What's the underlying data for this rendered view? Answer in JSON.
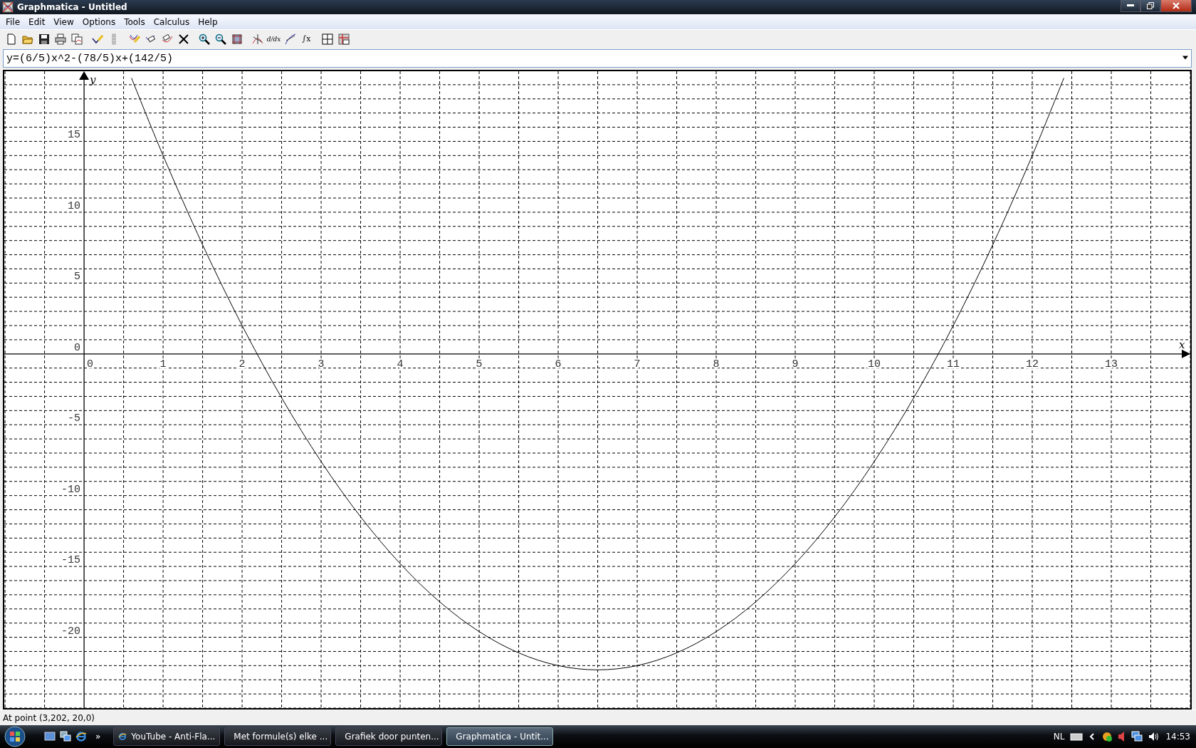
{
  "window": {
    "title": "Graphmatica - Untitled"
  },
  "menu": [
    "File",
    "Edit",
    "View",
    "Options",
    "Tools",
    "Calculus",
    "Help"
  ],
  "toolbar": {
    "groups": [
      [
        {
          "kind": "new"
        },
        {
          "kind": "open"
        },
        {
          "kind": "save"
        },
        {
          "kind": "print"
        },
        {
          "kind": "copy"
        }
      ],
      [
        {
          "kind": "pencil"
        },
        {
          "kind": "grip"
        }
      ],
      [
        {
          "kind": "graph-add"
        },
        {
          "kind": "eraser"
        },
        {
          "kind": "eraser-curve"
        },
        {
          "kind": "delete"
        }
      ],
      [
        {
          "kind": "zoom-in"
        },
        {
          "kind": "zoom-out"
        },
        {
          "kind": "fit"
        }
      ],
      [
        {
          "kind": "tangent"
        },
        {
          "kind": "derivative",
          "label": "d/dx"
        },
        {
          "kind": "slope"
        },
        {
          "kind": "integral",
          "label": "∫x"
        }
      ],
      [
        {
          "kind": "table"
        },
        {
          "kind": "table-edit"
        }
      ]
    ]
  },
  "equation": {
    "value": "y=(6/5)x^2-(78/5)x+(142/5)"
  },
  "graph": {
    "chart_data": {
      "type": "line",
      "xlabel": "x",
      "ylabel": "y",
      "xlim": [
        -1.01,
        14.0
      ],
      "ylim": [
        -25,
        19.95
      ],
      "xticks": [
        0,
        1,
        2,
        3,
        4,
        5,
        6,
        7,
        8,
        9,
        10,
        11,
        12,
        13
      ],
      "yticks": [
        -20,
        -15,
        -10,
        -5,
        0,
        5,
        10,
        15
      ],
      "grid": true,
      "x": [
        0.6,
        1,
        1.5,
        2,
        2.5,
        3,
        3.5,
        4,
        4.5,
        5,
        5.5,
        6,
        6.5,
        7,
        7.5,
        8,
        8.5,
        9,
        9.5,
        10,
        10.5,
        11,
        11.5,
        12,
        12.4
      ],
      "series": [
        {
          "color": "#000000",
          "values": [
            19.47,
            14,
            7.7,
            2,
            -3.1,
            -7.6,
            -11.5,
            -14.8,
            -17.5,
            -19.6,
            -21.1,
            -22,
            -22.3,
            -22,
            -21.1,
            -19.6,
            -17.5,
            -14.8,
            -11.5,
            -7.6,
            -3.1,
            2,
            7.7,
            14,
            19.47
          ]
        }
      ]
    }
  },
  "status_bar": "At point (3,202, 20,0)",
  "taskbar": {
    "more": "»",
    "tasks": [
      {
        "kind": "browser",
        "label": "YouTube - Anti-Fla...",
        "selected": false
      },
      {
        "kind": "browser",
        "label": "Met formule(s) elke ...",
        "selected": false
      },
      {
        "kind": "browser",
        "label": "Grafiek door punten...",
        "selected": false
      },
      {
        "kind": "app",
        "label": "Graphmatica - Untit...",
        "selected": true
      }
    ],
    "language": "NL",
    "clock": "14:53"
  }
}
